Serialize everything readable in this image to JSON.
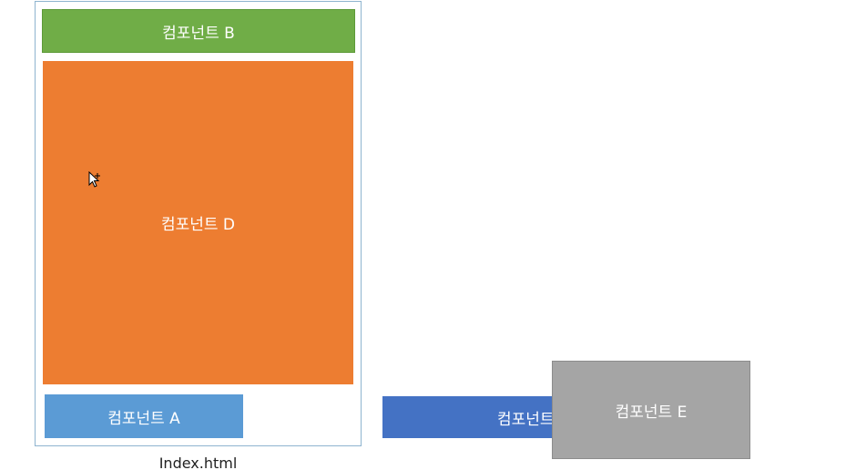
{
  "diagram": {
    "components": {
      "b": {
        "label": "컴포넌트 B",
        "color": "#70ad47"
      },
      "d": {
        "label": "컴포넌트 D",
        "color": "#ed7d31"
      },
      "a": {
        "label": "컴포넌트 A",
        "color": "#5b9bd5"
      },
      "c": {
        "label": "컴포넌트 C",
        "color": "#4472c4"
      },
      "e": {
        "label": "컴포넌트 E",
        "color": "#a5a5a5"
      }
    },
    "container_caption": "Index.html",
    "cursor_icon": "move-cursor-icon"
  }
}
